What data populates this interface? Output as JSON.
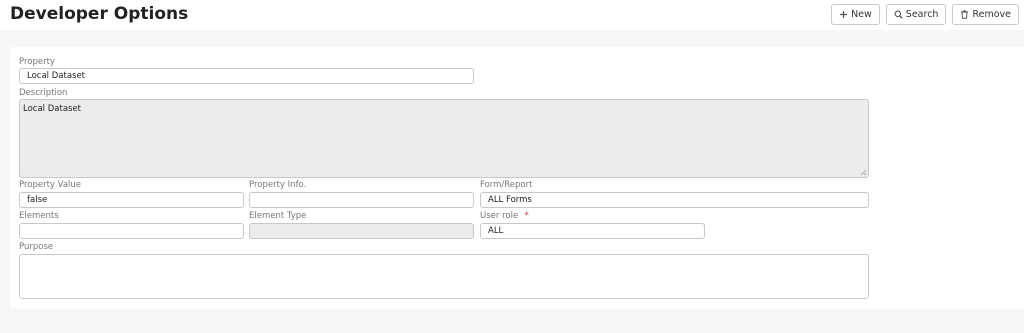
{
  "header": {
    "title": "Developer Options",
    "buttons": {
      "new": "New",
      "search": "Search",
      "remove": "Remove"
    }
  },
  "form": {
    "property": {
      "label": "Property",
      "value": "Local Dataset"
    },
    "description": {
      "label": "Description",
      "value": "Local Dataset"
    },
    "property_value": {
      "label": "Property Value",
      "value": "false"
    },
    "property_info": {
      "label": "Property Info.",
      "value": ""
    },
    "form_report": {
      "label": "Form/Report",
      "value": "ALL Forms"
    },
    "elements": {
      "label": "Elements",
      "value": ""
    },
    "element_type": {
      "label": "Element Type",
      "value": ""
    },
    "user_role": {
      "label": "User role",
      "required_mark": "*",
      "value": "ALL"
    },
    "purpose": {
      "label": "Purpose",
      "value": ""
    }
  },
  "icons": {
    "new": "plus-icon",
    "search": "magnifier-icon",
    "remove": "trash-icon"
  },
  "colors": {
    "required": "#e03030",
    "disabled_field": "#ececec",
    "page_background": "#f5f6f8"
  }
}
